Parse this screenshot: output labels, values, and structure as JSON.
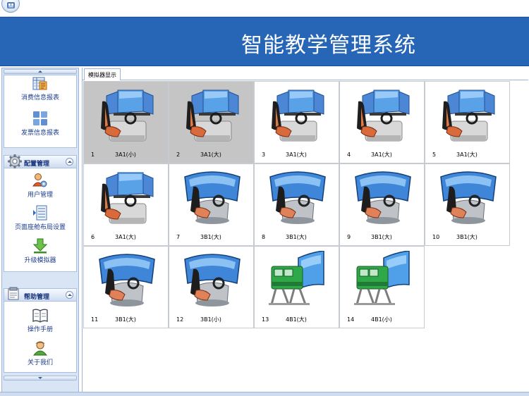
{
  "app": {
    "title": "智能教学管理系统"
  },
  "sidebar": {
    "report_items": [
      {
        "label": "消费信息报表",
        "icon": "report-sheet-icon"
      },
      {
        "label": "发票信息报表",
        "icon": "invoice-grid-icon"
      }
    ],
    "config_panel": {
      "title": "配置管理",
      "icon": "gear-icon",
      "items": [
        {
          "label": "用户管理",
          "icon": "user-settings-icon"
        },
        {
          "label": "页面座舱布局设置",
          "icon": "layout-list-icon"
        },
        {
          "label": "升级模拟器",
          "icon": "download-arrow-icon"
        }
      ]
    },
    "help_panel": {
      "title": "帮助管理",
      "icon": "notepad-icon",
      "items": [
        {
          "label": "操作手册",
          "icon": "book-icon"
        },
        {
          "label": "关于我们",
          "icon": "person-icon"
        }
      ]
    }
  },
  "main": {
    "tab_label": "模拟器显示",
    "simulators": [
      {
        "num": "1",
        "model": "3A1(小)",
        "kind": "A",
        "selected": true
      },
      {
        "num": "2",
        "model": "3A1(大)",
        "kind": "A",
        "selected": true
      },
      {
        "num": "3",
        "model": "3A1(大)",
        "kind": "A",
        "selected": false
      },
      {
        "num": "4",
        "model": "3A1(大)",
        "kind": "A",
        "selected": false
      },
      {
        "num": "5",
        "model": "3A1(大)",
        "kind": "A",
        "selected": false
      },
      {
        "num": "6",
        "model": "3A1(大)",
        "kind": "A",
        "selected": false
      },
      {
        "num": "7",
        "model": "3B1(大)",
        "kind": "B",
        "selected": false
      },
      {
        "num": "8",
        "model": "3B1(大)",
        "kind": "B",
        "selected": false
      },
      {
        "num": "9",
        "model": "3B1(大)",
        "kind": "B",
        "selected": false
      },
      {
        "num": "10",
        "model": "3B1(大)",
        "kind": "B",
        "selected": false
      },
      {
        "num": "11",
        "model": "3B1(大)",
        "kind": "B",
        "selected": false
      },
      {
        "num": "12",
        "model": "3B1(小)",
        "kind": "B",
        "selected": false
      },
      {
        "num": "13",
        "model": "4B1(大)",
        "kind": "C",
        "selected": false
      },
      {
        "num": "14",
        "model": "4B1(小)",
        "kind": "C",
        "selected": false
      }
    ]
  },
  "colors": {
    "banner": "#2765b6",
    "selected_cell": "#c5c5c5",
    "sidebar_bg": "#d9e5f4"
  }
}
